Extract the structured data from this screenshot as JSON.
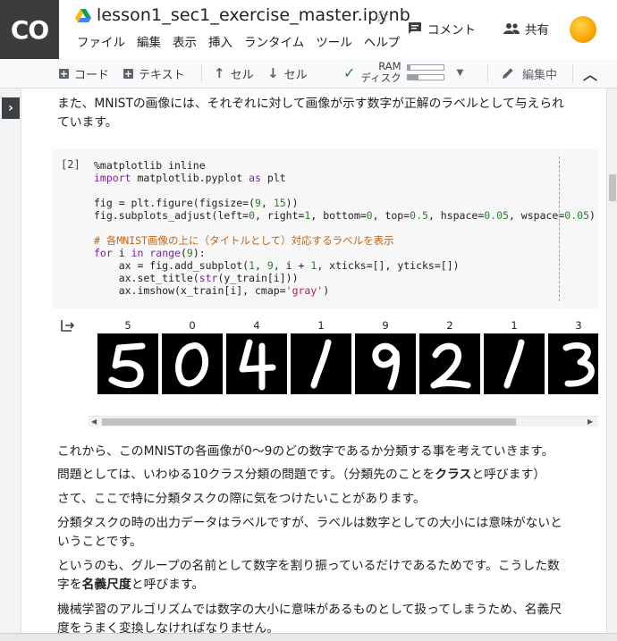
{
  "header": {
    "logo": "CO",
    "notebook_title": "lesson1_sec1_exercise_master.ipynb",
    "menu": [
      "ファイル",
      "編集",
      "表示",
      "挿入",
      "ランタイム",
      "ツール",
      "ヘルプ"
    ],
    "comment_label": "コメント",
    "share_label": "共有"
  },
  "toolbar": {
    "code_label": "コード",
    "text_label": "テキスト",
    "cell_up_label": "セル",
    "cell_down_label": "セル",
    "ram_label": "RAM",
    "disk_label": "ディスク",
    "ram_usage": 0.08,
    "disk_usage": 0.3,
    "edit_label": "編集中"
  },
  "main": {
    "intro_text": "また、MNISTの画像には、それぞれに対して画像が示す数字が正解のラベルとして与えられています。",
    "code_cell": {
      "exec_count": "[2]",
      "lines": [
        "%matplotlib inline",
        "import matplotlib.pyplot as plt",
        "",
        "fig = plt.figure(figsize=(9, 15))",
        "fig.subplots_adjust(left=0, right=1, bottom=0, top=0.5, hspace=0.05, wspace=0.05)",
        "",
        "# 各MNIST画像の上に（タイトルとして）対応するラベルを表示",
        "for i in range(9):",
        "    ax = fig.add_subplot(1, 9, i + 1, xticks=[], yticks=[])",
        "    ax.set_title(str(y_train[i]))",
        "    ax.imshow(x_train[i], cmap='gray')"
      ]
    },
    "output_digits": [
      "5",
      "0",
      "4",
      "1",
      "9",
      "2",
      "1",
      "3"
    ],
    "paragraphs": [
      {
        "parts": [
          {
            "t": "これから、このMNISTの各画像が0～9のどの数字であるか分類する事を考えていきます。",
            "b": false
          }
        ]
      },
      {
        "parts": [
          {
            "t": "問題としては、いわゆる10クラス分類の問題です。（分類先のことを",
            "b": false
          },
          {
            "t": "クラス",
            "b": true
          },
          {
            "t": "と呼びます）",
            "b": false
          }
        ]
      },
      {
        "parts": [
          {
            "t": "さて、ここで特に分類タスクの際に気をつけたいことがあります。",
            "b": false
          }
        ]
      },
      {
        "parts": [
          {
            "t": "分類タスクの時の出力データはラベルですが、ラベルは数字としての大小には意味がないということです。",
            "b": false
          }
        ]
      },
      {
        "parts": [
          {
            "t": "というのも、グループの名前として数字を割り振っているだけであるためです。こうした数字を",
            "b": false
          },
          {
            "t": "名義尺度",
            "b": true
          },
          {
            "t": "と呼びます。",
            "b": false
          }
        ]
      },
      {
        "parts": [
          {
            "t": "機械学習のアルゴリズムでは数字の大小に意味があるものとして扱ってしまうため、名義尺度をうまく変換しなければなりません。",
            "b": false
          }
        ]
      }
    ]
  },
  "colors": {
    "logo_bg": "#3c3c3c",
    "toolbar_bg": "#f8f9fa",
    "code_bg": "#f7f7f7",
    "keyword": "#7b1fa2",
    "number": "#2e7d32",
    "string": "#c2185b",
    "comment": "#c0671b"
  }
}
